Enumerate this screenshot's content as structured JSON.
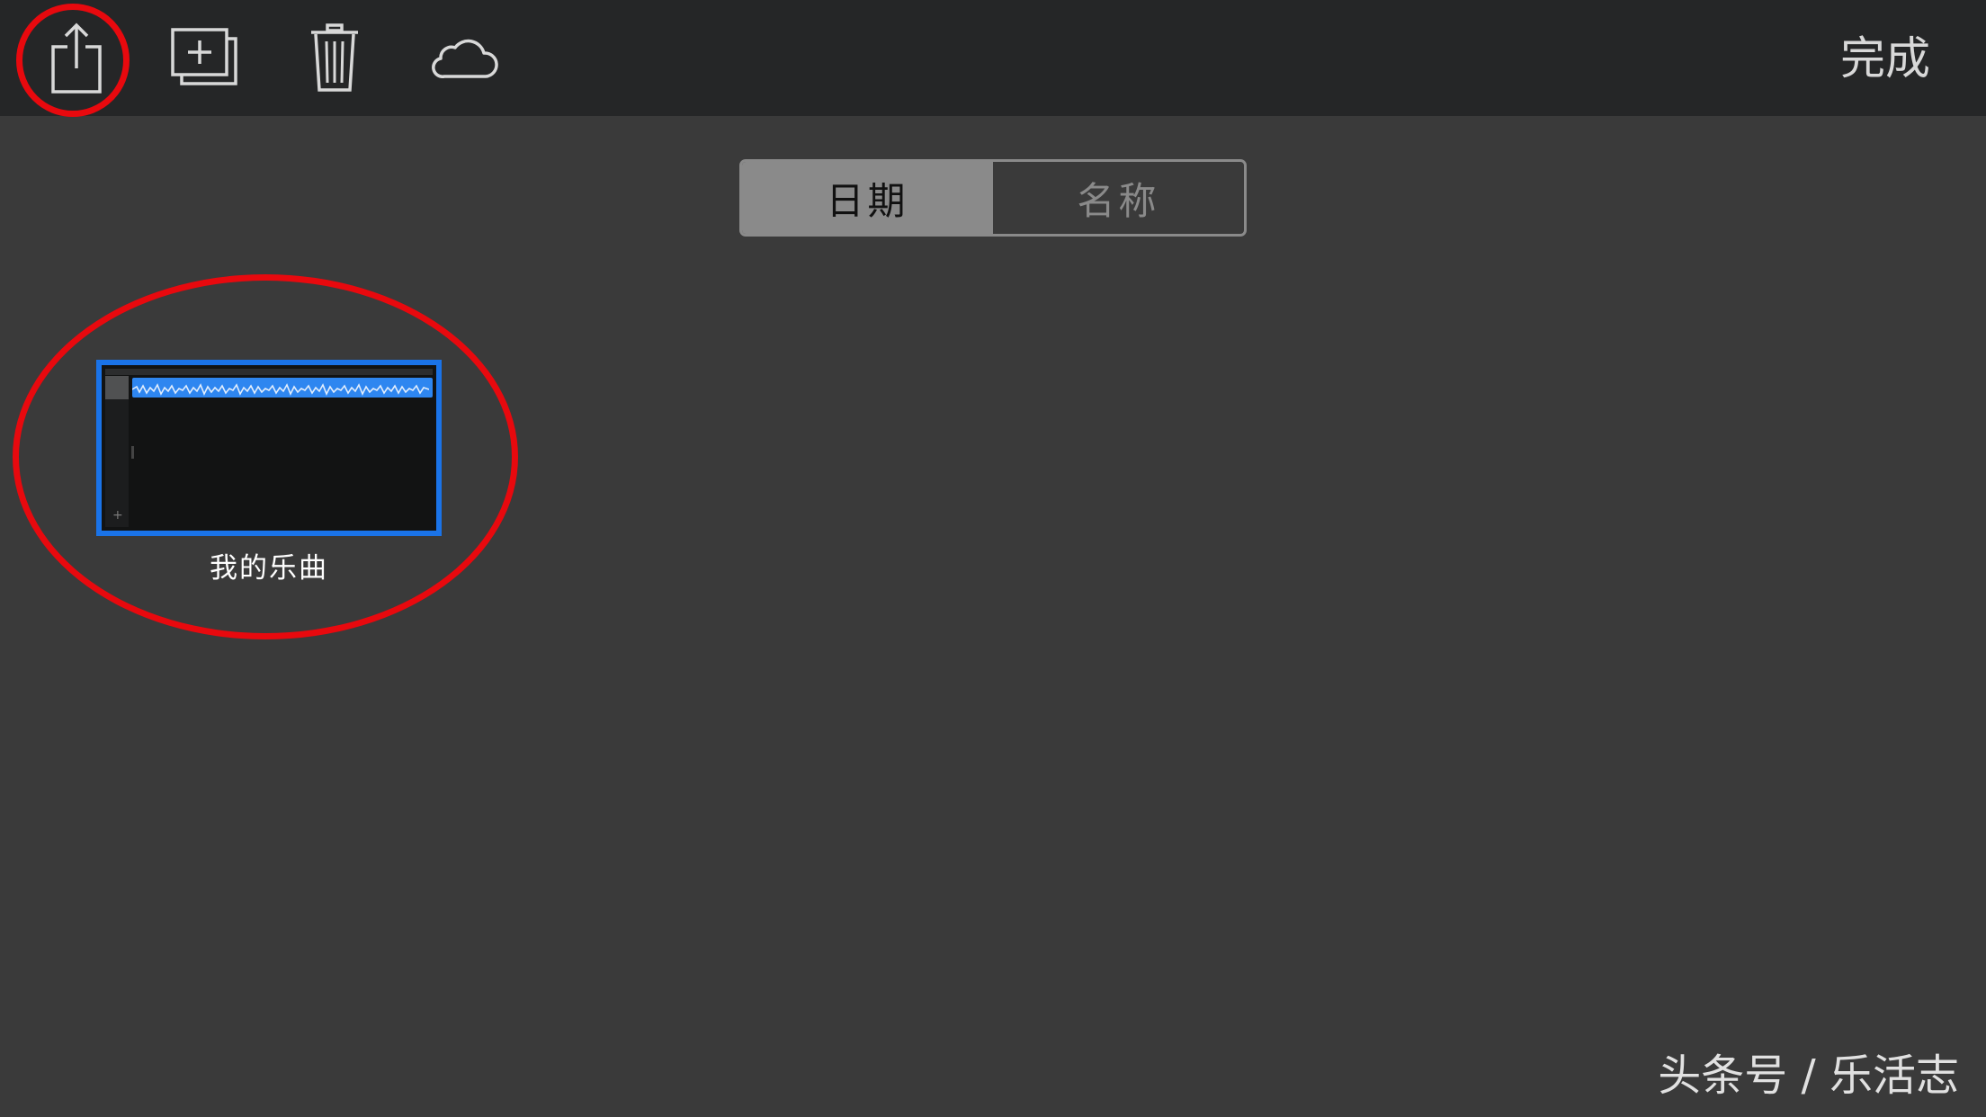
{
  "toolbar": {
    "buttons": [
      {
        "name": "share",
        "icon": "share-icon"
      },
      {
        "name": "duplicate",
        "icon": "duplicate-icon"
      },
      {
        "name": "delete",
        "icon": "trash-icon"
      },
      {
        "name": "icloud",
        "icon": "cloud-icon"
      }
    ],
    "done_label": "完成"
  },
  "sort": {
    "options": [
      {
        "label": "日期",
        "selected": true
      },
      {
        "label": "名称",
        "selected": false
      }
    ]
  },
  "projects": [
    {
      "name": "我的乐曲",
      "selected": true
    }
  ],
  "watermark": "头条号 / 乐活志",
  "colors": {
    "toolbar_bg": "#252627",
    "background": "#3a3a3a",
    "selection": "#1a73e8",
    "annotation": "#e8090e",
    "region": "#2e86f0"
  }
}
